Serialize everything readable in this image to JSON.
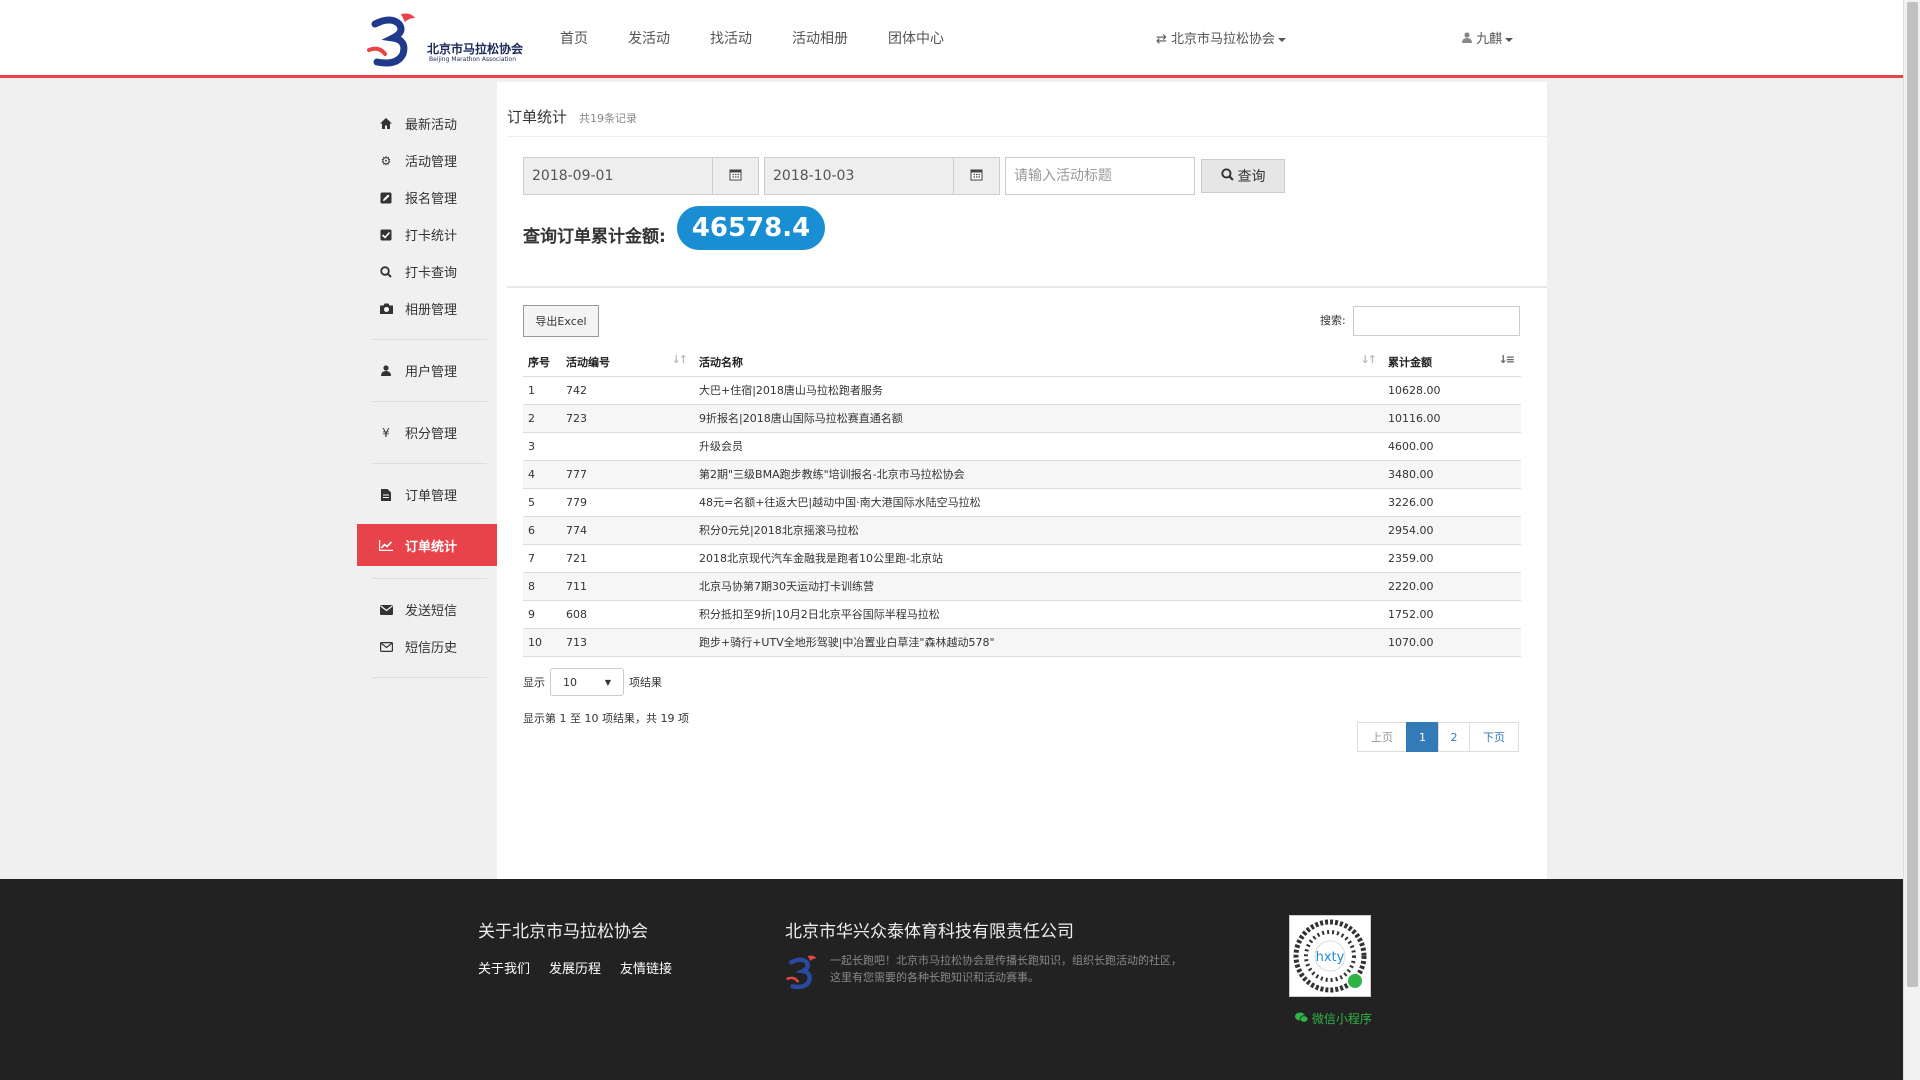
{
  "header": {
    "logo_text": "北京市马拉松协会",
    "logo_subtext": "Beijing Marathon Association",
    "nav": [
      "首页",
      "发活动",
      "找活动",
      "活动相册",
      "团体中心"
    ],
    "org_switch": "北京市马拉松协会",
    "user": "九麒"
  },
  "sidebar": {
    "groups": [
      [
        {
          "label": "最新活动",
          "icon": "home-icon"
        },
        {
          "label": "活动管理",
          "icon": "gear-icon"
        },
        {
          "label": "报名管理",
          "icon": "edit-icon"
        },
        {
          "label": "打卡统计",
          "icon": "check-square-icon"
        },
        {
          "label": "打卡查询",
          "icon": "search-icon"
        },
        {
          "label": "相册管理",
          "icon": "camera-icon"
        }
      ],
      [
        {
          "label": "用户管理",
          "icon": "user-icon"
        }
      ],
      [
        {
          "label": "积分管理",
          "icon": "yen-icon"
        }
      ],
      [
        {
          "label": "订单管理",
          "icon": "file-icon"
        }
      ],
      [
        {
          "label": "订单统计",
          "icon": "line-chart-icon",
          "active": true
        }
      ],
      [
        {
          "label": "发送短信",
          "icon": "envelope-icon"
        },
        {
          "label": "短信历史",
          "icon": "envelope-outline-icon"
        }
      ]
    ]
  },
  "main": {
    "title": "订单统计",
    "record_count": "共19条记录",
    "start_date": "2018-09-01",
    "end_date": "2018-10-03",
    "title_placeholder": "请输入活动标题",
    "query_label": "查询",
    "total_label": "查询订单累计金额:",
    "total_value": "46578.4",
    "export_label": "导出Excel",
    "search_label": "搜索:",
    "columns": [
      "序号",
      "活动编号",
      "活动名称",
      "累计金额"
    ],
    "rows": [
      {
        "no": "1",
        "code": "742",
        "name": "大巴+住宿|2018唐山马拉松跑者服务",
        "amount": "10628.00"
      },
      {
        "no": "2",
        "code": "723",
        "name": "9折报名|2018唐山国际马拉松赛直通名额",
        "amount": "10116.00"
      },
      {
        "no": "3",
        "code": "",
        "name": "升级会员",
        "amount": "4600.00"
      },
      {
        "no": "4",
        "code": "777",
        "name": "第2期\"三级BMA跑步教练\"培训报名-北京市马拉松协会",
        "amount": "3480.00"
      },
      {
        "no": "5",
        "code": "779",
        "name": "48元=名额+往返大巴|越动中国·南大港国际水陆空马拉松",
        "amount": "3226.00"
      },
      {
        "no": "6",
        "code": "774",
        "name": "积分0元兑|2018北京摇滚马拉松",
        "amount": "2954.00"
      },
      {
        "no": "7",
        "code": "721",
        "name": "2018北京现代汽车金融我是跑者10公里跑-北京站",
        "amount": "2359.00"
      },
      {
        "no": "8",
        "code": "711",
        "name": "北京马协第7期30天运动打卡训练营",
        "amount": "2220.00"
      },
      {
        "no": "9",
        "code": "608",
        "name": "积分抵扣至9折|10月2日北京平谷国际半程马拉松",
        "amount": "1752.00"
      },
      {
        "no": "10",
        "code": "713",
        "name": "跑步+骑行+UTV全地形驾驶|中冶置业白草洼\"森林越动578\"",
        "amount": "1070.00"
      }
    ],
    "length_prefix": "显示",
    "length_value": "10",
    "length_suffix": "项结果",
    "info": "显示第 1 至 10 项结果，共 19 项",
    "pager": {
      "prev": "上页",
      "pages": [
        "1",
        "2"
      ],
      "current": "1",
      "next": "下页"
    }
  },
  "footer": {
    "about_title": "关于北京市马拉松协会",
    "links": [
      "关于我们",
      "发展历程",
      "友情链接"
    ],
    "company": "北京市华兴众泰体育科技有限责任公司",
    "desc": "一起长跑吧！北京市马拉松协会是传播长跑知识，组织长跑活动的社区，这里有您需要的各种长跑知识和活动赛事。",
    "qr_label": "微信小程序"
  },
  "colors": {
    "accent": "#e8434a",
    "total_pill": "#1a8ed3",
    "pager_active": "#337ab7",
    "footer_bg": "#222222",
    "wechat": "#2fb345"
  }
}
